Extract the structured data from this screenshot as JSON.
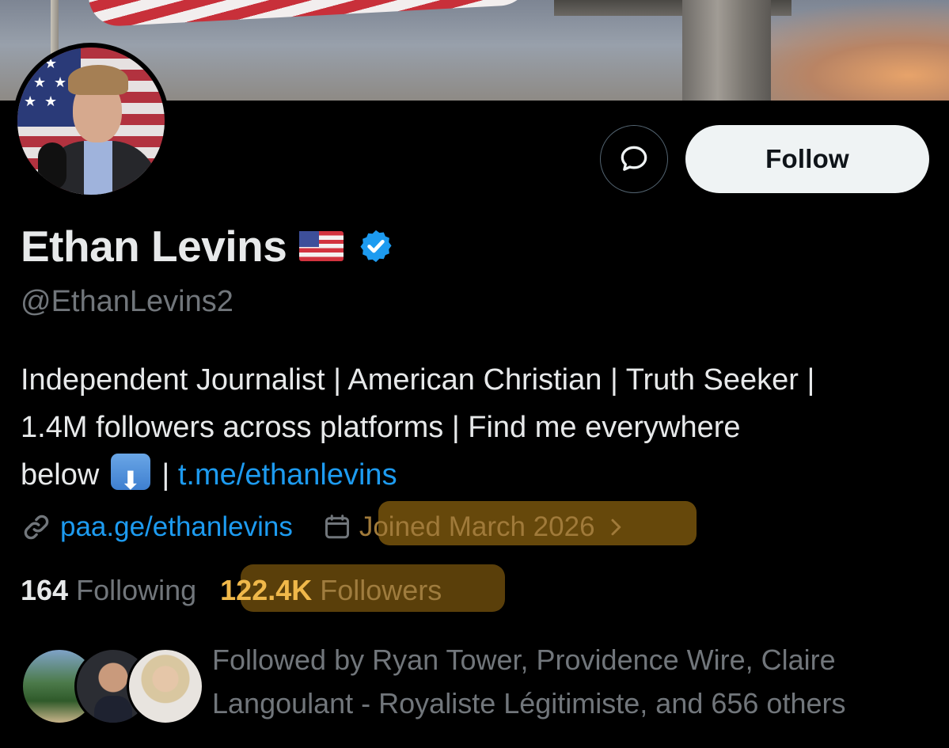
{
  "profile": {
    "name": "Ethan Levins",
    "handle": "@EthanLevins2",
    "bio_line1": "Independent Journalist | American Christian | Truth Seeker |",
    "bio_line2": "1.4M followers across platforms | Find me everywhere",
    "bio_line3_prefix": "below",
    "bio_line3_separator": "|",
    "bio_link": "t.me/ethanlevins",
    "website": "paa.ge/ethanlevins",
    "joined": "Joined March 2026",
    "following_count": "164",
    "following_label": "Following",
    "followers_count": "122.4K",
    "followers_label": "Followers"
  },
  "actions": {
    "follow_label": "Follow"
  },
  "followed_by": {
    "line1": "Followed by Ryan Tower, Providence Wire, Claire",
    "line2": "Langoulant - Royaliste Légitimiste, and 656 others"
  },
  "icons": {
    "message": "message-icon",
    "verified": "verified-badge-icon",
    "link": "link-icon",
    "calendar": "calendar-icon",
    "chevron": "chevron-right-icon",
    "flag": "us-flag-emoji",
    "arrow": "down-arrow-emoji"
  },
  "colors": {
    "background": "#000000",
    "accent_link": "#1d9bf0",
    "secondary_text": "#71767b",
    "highlight_marker": "#d69618"
  }
}
